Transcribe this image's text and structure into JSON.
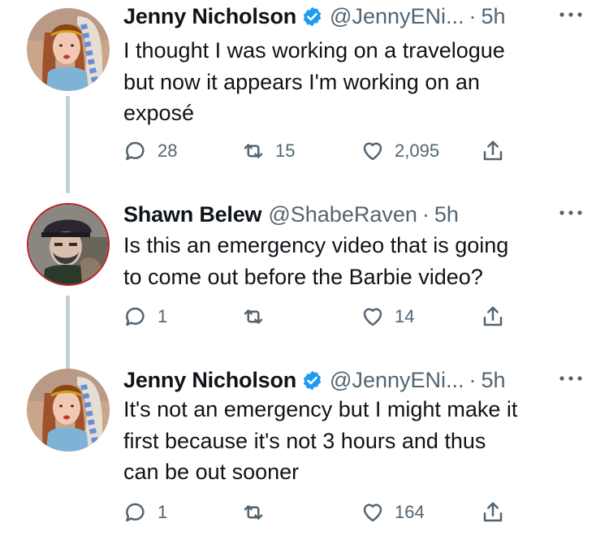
{
  "tweets": [
    {
      "author_name": "Jenny Nicholson",
      "handle": "@JennyENi...",
      "dot": "·",
      "time": "5h",
      "verified": true,
      "lines": [
        "I thought I was working on a travelogue",
        "but now it appears I'm working on an",
        "exposé"
      ],
      "replies": "28",
      "retweets": "15",
      "likes": "2,095"
    },
    {
      "author_name": "Shawn Belew",
      "handle": "@ShabeRaven",
      "dot": "·",
      "time": "5h",
      "verified": false,
      "lines": [
        "Is this an emergency video that is going",
        "to come out before the Barbie video?"
      ],
      "replies": "1",
      "retweets": "",
      "likes": "14"
    },
    {
      "author_name": "Jenny Nicholson",
      "handle": "@JennyENi...",
      "dot": "·",
      "time": "5h",
      "verified": true,
      "lines": [
        "It's not an emergency but I might make it",
        "first because it's not 3 hours and thus",
        "can be out sooner"
      ],
      "replies": "1",
      "retweets": "",
      "likes": "164"
    }
  ],
  "colors": {
    "secondary_text": "#536471",
    "verified_blue": "#1d9bf0",
    "thread_line": "#c4cfd6"
  },
  "icons": [
    "verified-icon",
    "more-icon",
    "reply-icon",
    "retweet-icon",
    "like-icon",
    "share-icon"
  ]
}
